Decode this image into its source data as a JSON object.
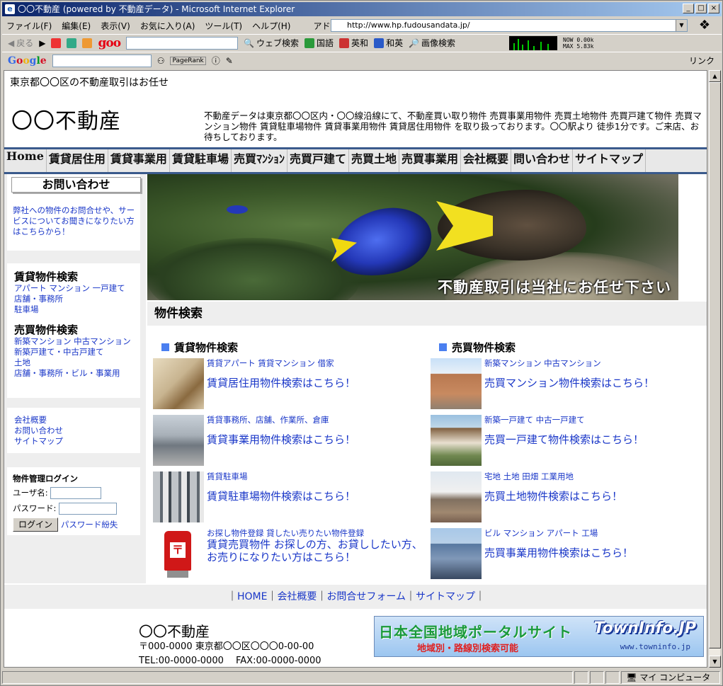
{
  "window": {
    "title": "〇〇不動産 (powered by 不動産データ) - Microsoft Internet Explorer",
    "controls": [
      "_",
      "□",
      "×"
    ]
  },
  "menubar": {
    "items": [
      "ファイル(F)",
      "編集(E)",
      "表示(V)",
      "お気に入り(A)",
      "ツール(T)",
      "ヘルプ(H)"
    ],
    "address_label": "アドレス(D)",
    "address_value": "http://www.hp.fudousandata.jp/"
  },
  "toolbar1": {
    "back": "戻る",
    "web_search": "ウェブ検索",
    "kokugo": "国語",
    "eiwa": "英和",
    "waei": "和英",
    "image_search": "画像検索",
    "goo_logo": "goo",
    "meter_now": "NOW 0.00k",
    "meter_max": "MAX 5.83k"
  },
  "toolbar2": {
    "google": [
      "G",
      "o",
      "o",
      "g",
      "l",
      "e"
    ],
    "pagerank": "PageRank",
    "links": "リンク"
  },
  "page": {
    "tagline": "東京都〇〇区の不動産取引はお任せ",
    "logo": "〇〇不動産",
    "intro": "不動産データは東京都〇〇区内・〇〇線沿線にて、不動産買い取り物件 売買事業用物件 売買土地物件 売買戸建て物件 売買マンション物件 賃貸駐車場物件 賃貸事業用物件 賃貸居住用物件 を取り扱っております。〇〇駅より 徒歩1分です。ご来店、お待ちしております。",
    "nav": [
      "Home",
      "賃貸居住用",
      "賃貸事業用",
      "賃貸駐車場",
      "売買ﾏﾝｼｮﾝ",
      "売買戸建て",
      "売買土地",
      "売買事業用",
      "会社概要",
      "問い合わせ",
      "サイトマップ"
    ],
    "sidebar": {
      "contact_button": "お問い合わせ",
      "contact_text": "弊社への物件のお問合せや、サービスについてお聞きになりたい方はこちらから！",
      "rent_head": "賃貸物件検索",
      "rent_links": [
        "アパート マンション 一戸建て",
        "店舗・事務所",
        "駐車場"
      ],
      "sale_head": "売買物件検索",
      "sale_links": [
        "新築マンション 中古マンション",
        "新築戸建て・中古戸建て",
        "土地",
        "店舗・事務所・ビル・事業用"
      ],
      "misc_links": [
        "会社概要",
        "お問い合わせ",
        "サイトマップ"
      ],
      "login_title": "物件管理ログイン",
      "user_label": "ユーザ名",
      "pass_label": "パスワード",
      "login_button": "ログイン",
      "forgot": "パスワード紛失"
    },
    "hero_caption": "不動産取引は当社にお任せ下さい",
    "section_title": "物件検索",
    "rent_col": {
      "head": "賃貸物件検索",
      "items": [
        {
          "small": "賃貸アパート 賃貸マンション 借家",
          "big": "賃貸居住用物件検索はこちら！"
        },
        {
          "small": "賃貸事務所、店舗、作業所、倉庫",
          "big": "賃貸事業用物件検索はこちら！"
        },
        {
          "small": "賃貸駐車場",
          "big": "賃貸駐車場物件検索はこちら！"
        },
        {
          "small": "お探し物件登録 貸したい売りたい物件登録",
          "big": "賃貸売買物件 お探しの方、お貸ししたい方、お売りになりたい方はこちら！"
        }
      ]
    },
    "sale_col": {
      "head": "売買物件検索",
      "items": [
        {
          "small": "新築マンション 中古マンション",
          "big": "売買マンション物件検索はこちら！"
        },
        {
          "small": "新築一戸建て 中古一戸建て",
          "big": "売買一戸建て物件検索はこちら！"
        },
        {
          "small": "宅地 土地 田畑 工業用地",
          "big": "売買土地物件検索はこちら！"
        },
        {
          "small": "ビル マンション アパート 工場",
          "big": "売買事業用物件検索はこちら！"
        }
      ]
    },
    "footer_links": [
      "HOME",
      "会社概要",
      "お問合せフォーム",
      "サイトマップ"
    ],
    "footer": {
      "name": "〇〇不動産",
      "address": "〒000-0000 東京都〇〇区〇〇〇0-00-00",
      "tel": "TEL:00-0000-0000　 FAX:00-0000-0000"
    },
    "banner": {
      "title": "日本全国地域ポータルサイト",
      "sub": "地域別・路線別検索可能",
      "logo": "TownInfo.JP",
      "url": "www.towninfo.jp"
    }
  },
  "status": {
    "zone": "マイ コンピュータ"
  }
}
